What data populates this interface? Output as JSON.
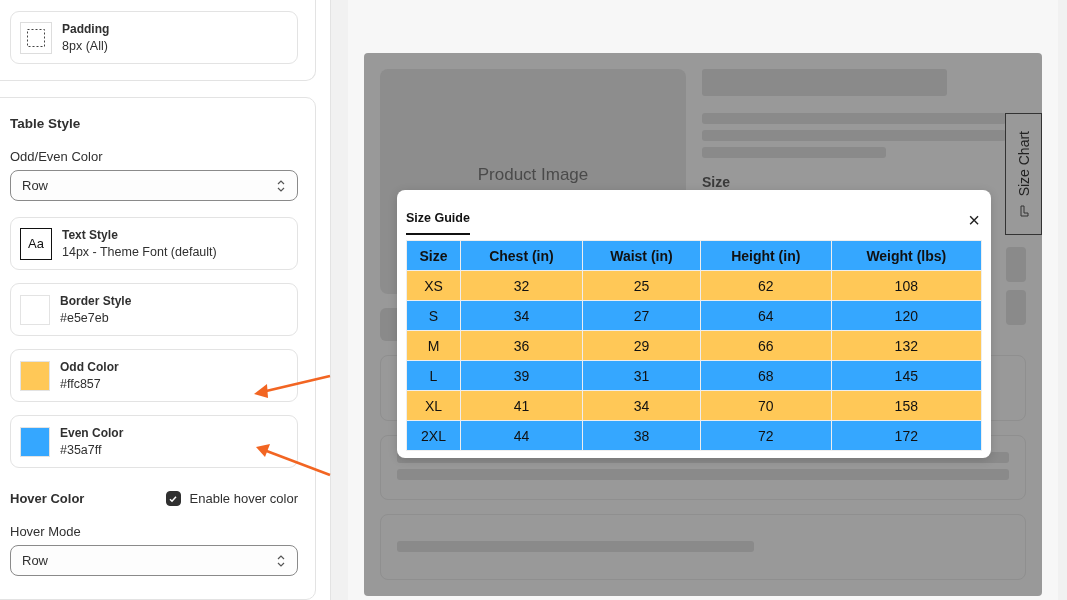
{
  "layout_section": {
    "padding": {
      "label": "Padding",
      "value": "8px (All)"
    }
  },
  "table_style": {
    "title": "Table Style",
    "odd_even_label": "Odd/Even Color",
    "odd_even_select": "Row",
    "cards": [
      {
        "kind": "text",
        "label": "Text Style",
        "value": "14px - Theme Font (default)",
        "icon_text": "Aa"
      },
      {
        "kind": "border",
        "label": "Border Style",
        "value": "#e5e7eb",
        "color": "#ffffff"
      },
      {
        "kind": "odd",
        "label": "Odd Color",
        "value": "#ffc857",
        "color": "#ffc857"
      },
      {
        "kind": "even",
        "label": "Even Color",
        "value": "#35a7ff",
        "color": "#35a7ff"
      }
    ],
    "hover_label": "Hover Color",
    "hover_checkbox": {
      "label": "Enable hover color",
      "checked": true
    },
    "hover_mode_label": "Hover Mode",
    "hover_mode_select": "Row"
  },
  "preview": {
    "image_label": "Product Image",
    "size_label": "Size",
    "size_chart_tab": "Size Chart",
    "modal": {
      "tab": "Size Guide",
      "close": "×",
      "columns": [
        "Size",
        "Chest (in)",
        "Waist (in)",
        "Height (in)",
        "Weight (lbs)"
      ],
      "rows": [
        [
          "XS",
          "32",
          "25",
          "62",
          "108"
        ],
        [
          "S",
          "34",
          "27",
          "64",
          "120"
        ],
        [
          "M",
          "36",
          "29",
          "66",
          "132"
        ],
        [
          "L",
          "39",
          "31",
          "68",
          "145"
        ],
        [
          "XL",
          "41",
          "34",
          "70",
          "158"
        ],
        [
          "2XL",
          "44",
          "38",
          "72",
          "172"
        ]
      ]
    }
  }
}
